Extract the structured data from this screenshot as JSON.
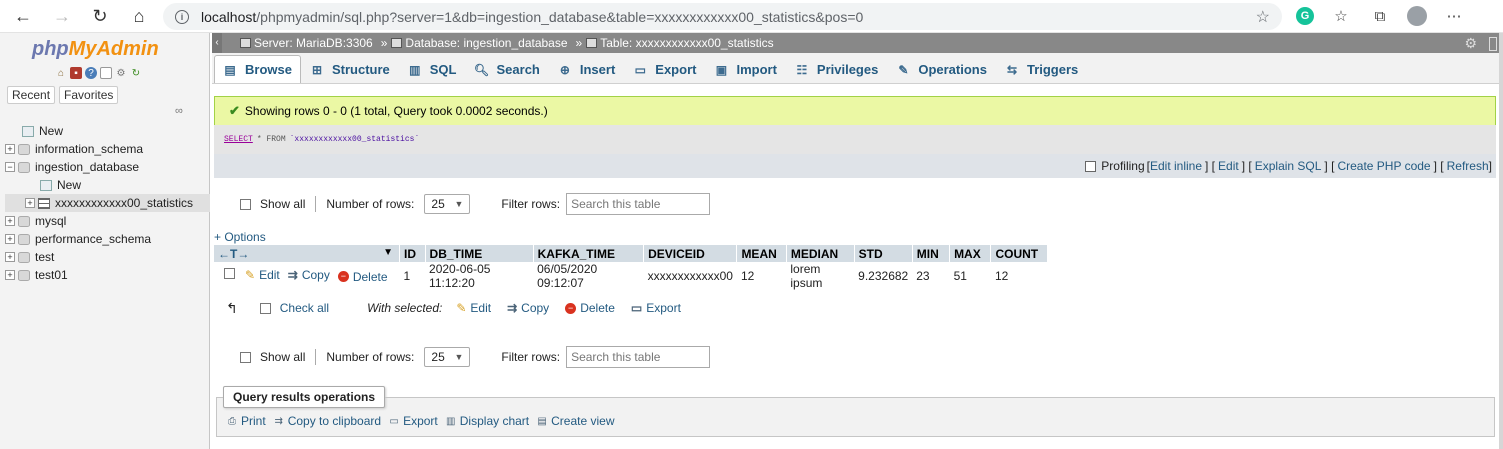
{
  "browser": {
    "url_host": "localhost",
    "url_rest": "/phpmyadmin/sql.php?server=1&db=ingestion_database&table=xxxxxxxxxxxx00_statistics&pos=0"
  },
  "nav": {
    "logo_php": "php",
    "logo_admin": "MyAdmin",
    "tab_recent": "Recent",
    "tab_favorites": "Favorites",
    "tree": [
      {
        "label": "New",
        "type": "new",
        "level": 0
      },
      {
        "label": "information_schema",
        "type": "db",
        "level": 0
      },
      {
        "label": "ingestion_database",
        "type": "db",
        "level": 0
      },
      {
        "label": "New",
        "type": "new",
        "level": 1
      },
      {
        "label": "xxxxxxxxxxxx00_statistics",
        "type": "table",
        "level": 1
      },
      {
        "label": "mysql",
        "type": "db",
        "level": 0
      },
      {
        "label": "performance_schema",
        "type": "db",
        "level": 0
      },
      {
        "label": "test",
        "type": "db",
        "level": 0
      },
      {
        "label": "test01",
        "type": "db",
        "level": 0
      }
    ]
  },
  "breadcrumb": {
    "server": "Server: MariaDB:3306",
    "database": "Database: ingestion_database",
    "table": "Table: xxxxxxxxxxxx00_statistics",
    "sep": "»"
  },
  "tabs": [
    {
      "label": "Browse",
      "icon": "browse-icon"
    },
    {
      "label": "Structure",
      "icon": "structure-icon"
    },
    {
      "label": "SQL",
      "icon": "sql-icon"
    },
    {
      "label": "Search",
      "icon": "search-icon"
    },
    {
      "label": "Insert",
      "icon": "insert-icon"
    },
    {
      "label": "Export",
      "icon": "export-icon"
    },
    {
      "label": "Import",
      "icon": "import-icon"
    },
    {
      "label": "Privileges",
      "icon": "privileges-icon"
    },
    {
      "label": "Operations",
      "icon": "operations-icon"
    },
    {
      "label": "Triggers",
      "icon": "triggers-icon"
    }
  ],
  "message": {
    "success": "Showing rows 0 - 0 (1 total, Query took 0.0002 seconds.)"
  },
  "sql": {
    "kw": "SELECT",
    "op": "* FROM",
    "table": "`xxxxxxxxxxxx00_statistics`"
  },
  "sql_actions": {
    "profiling": "Profiling",
    "open": "[",
    "edit_inline": "Edit inline",
    "sep": "] [",
    "edit": "Edit",
    "explain": "Explain SQL",
    "php": "Create PHP code",
    "refresh": "Refresh",
    "close": "]"
  },
  "nav_controls": {
    "show_all": "Show all",
    "num_rows_label": "Number of rows:",
    "num_rows_value": "25",
    "filter_label": "Filter rows:",
    "filter_placeholder": "Search this table"
  },
  "options_link": "+ Options",
  "table": {
    "arrows": "←T→",
    "columns": [
      "ID",
      "DB_TIME",
      "KAFKA_TIME",
      "DEVICEID",
      "MEAN",
      "MEDIAN",
      "STD",
      "MIN",
      "MAX",
      "COUNT"
    ],
    "rows": [
      {
        "actions": {
          "edit": "Edit",
          "copy": "Copy",
          "delete": "Delete"
        },
        "cells": [
          "1",
          "2020-06-05 11:12:20",
          "06/05/2020 09:12:07",
          "xxxxxxxxxxxx00",
          "12",
          "lorem ipsum",
          "9.232682",
          "23",
          "51",
          "12"
        ]
      }
    ]
  },
  "with_selected": {
    "check_all": "Check all",
    "label": "With selected:",
    "edit": "Edit",
    "copy": "Copy",
    "delete": "Delete",
    "export": "Export"
  },
  "query_ops": {
    "legend": "Query results operations",
    "print": "Print",
    "copy_clipboard": "Copy to clipboard",
    "export": "Export",
    "display_chart": "Display chart",
    "create_view": "Create view"
  }
}
